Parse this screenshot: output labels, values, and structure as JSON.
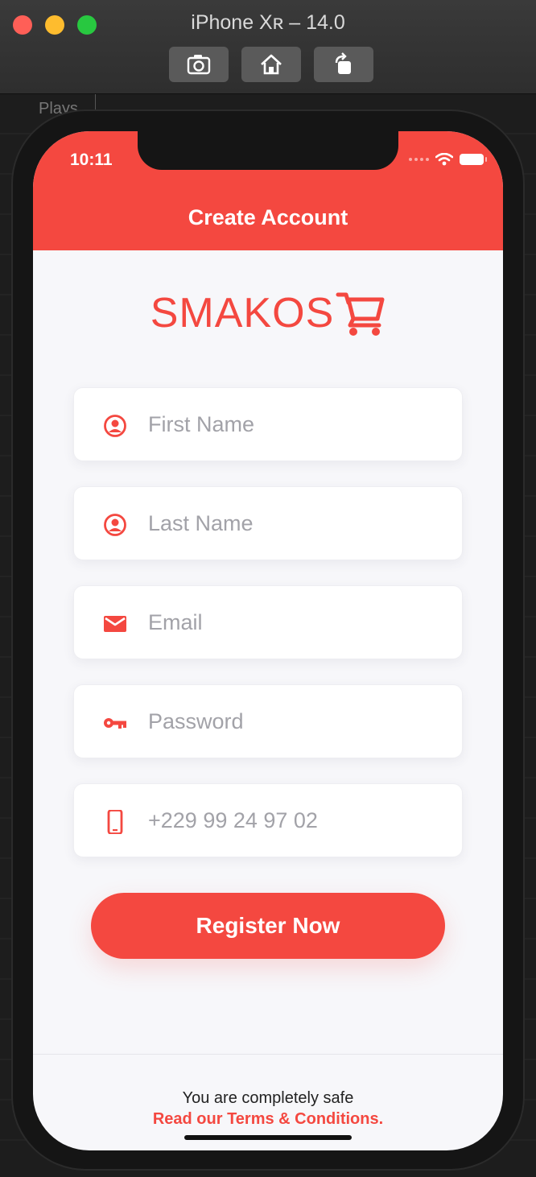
{
  "simulator": {
    "title": "iPhone Xʀ – 14.0",
    "buttons": [
      "screenshot-icon",
      "home-icon",
      "rotate-icon"
    ],
    "background_text": "Plays"
  },
  "status_bar": {
    "time": "10:11",
    "icons": [
      "signal-icon",
      "wifi-icon",
      "battery-icon"
    ]
  },
  "header": {
    "title": "Create Account",
    "color": "#f44840"
  },
  "logo": {
    "text": "SMAKOS",
    "icon": "cart-icon"
  },
  "form": {
    "first_name": {
      "placeholder": "First Name",
      "value": "",
      "icon": "user-circle-icon"
    },
    "last_name": {
      "placeholder": "Last Name",
      "value": "",
      "icon": "user-circle-icon"
    },
    "email": {
      "placeholder": "Email",
      "value": "",
      "icon": "mail-icon"
    },
    "password": {
      "placeholder": "Password",
      "value": "",
      "icon": "key-icon"
    },
    "phone": {
      "placeholder": "+229 99 24 97 02",
      "value": "",
      "icon": "phone-icon"
    }
  },
  "register_button": {
    "label": "Register Now"
  },
  "footer": {
    "text": "You are completely safe",
    "link": "Read our Terms & Conditions."
  }
}
